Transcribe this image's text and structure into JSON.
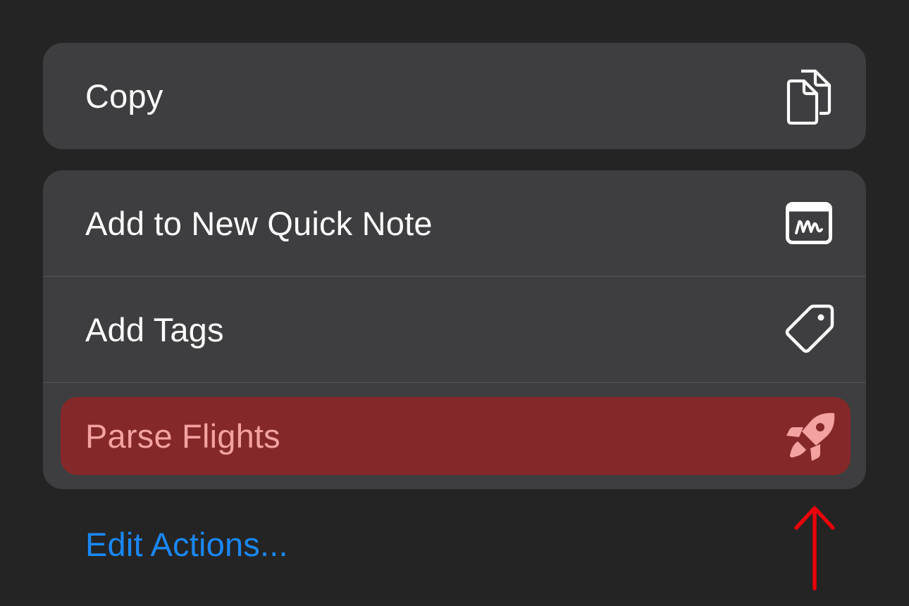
{
  "menu": {
    "copy_group": {
      "label": "Copy",
      "icon": "doc-on-doc-icon"
    },
    "actions_group": [
      {
        "label": "Add to New Quick Note",
        "icon": "quick-note-icon"
      },
      {
        "label": "Add Tags",
        "icon": "tag-icon"
      },
      {
        "label": "Parse Flights",
        "icon": "rocket-icon",
        "highlighted": true
      }
    ],
    "edit_actions_label": "Edit Actions..."
  },
  "colors": {
    "background": "#242424",
    "menu_surface": "#3e3e40",
    "highlight_fill": "#85282a",
    "highlight_text": "#f4a1a2",
    "link_blue": "#1a87f5",
    "annotation_red": "#e8000b"
  },
  "annotation": {
    "icon": "red-up-arrow-icon"
  }
}
